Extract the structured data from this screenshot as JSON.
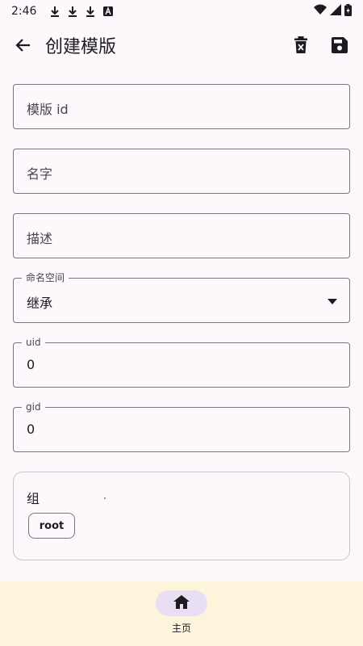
{
  "status_bar": {
    "time": "2:46"
  },
  "app_bar": {
    "title": "创建模版"
  },
  "form": {
    "template_id": {
      "placeholder": "模版 id"
    },
    "name": {
      "placeholder": "名字"
    },
    "description": {
      "placeholder": "描述"
    },
    "namespace": {
      "label": "命名空间",
      "value": "继承"
    },
    "uid": {
      "label": "uid",
      "value": "0"
    },
    "gid": {
      "label": "gid",
      "value": "0"
    }
  },
  "group_section": {
    "title": "组",
    "chips": [
      "root"
    ]
  },
  "bottom_nav": {
    "home_label": "主页"
  },
  "colors": {
    "background": "#fcf8fc",
    "nav_background": "#fcf5dc",
    "nav_active_pill": "#e8dff5"
  }
}
